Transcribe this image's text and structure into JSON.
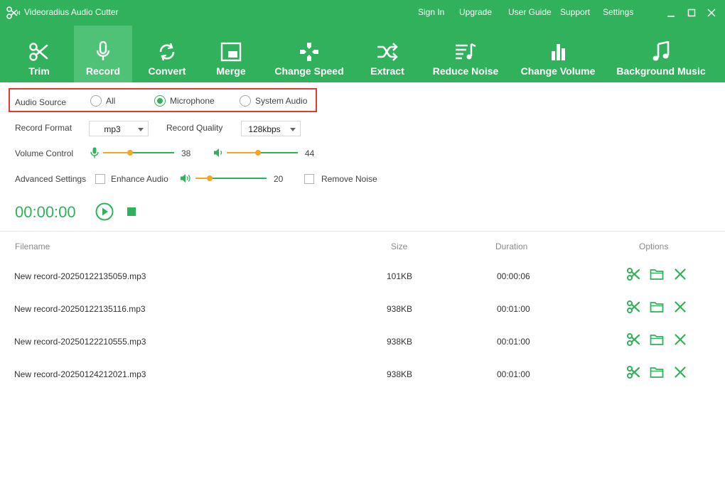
{
  "window": {
    "title": "Videoradius Audio Cutter",
    "menu": [
      "Sign In",
      "Upgrade",
      "User Guide",
      "Support",
      "Settings"
    ]
  },
  "toolbar": {
    "active": "Record",
    "items": [
      {
        "label": "Trim",
        "icon": "scissors-icon"
      },
      {
        "label": "Record",
        "icon": "microphone-icon"
      },
      {
        "label": "Convert",
        "icon": "convert-icon"
      },
      {
        "label": "Merge",
        "icon": "merge-icon"
      },
      {
        "label": "Change Speed",
        "icon": "gamepad-icon"
      },
      {
        "label": "Extract",
        "icon": "shuffle-icon"
      },
      {
        "label": "Reduce Noise",
        "icon": "reduce-noise-icon"
      },
      {
        "label": "Change Volume",
        "icon": "volume-bars-icon"
      },
      {
        "label": "Background Music",
        "icon": "music-note-icon"
      }
    ]
  },
  "settings": {
    "audio_source": {
      "label": "Audio Source",
      "options": [
        "All",
        "Microphone",
        "System Audio"
      ],
      "selected": "Microphone"
    },
    "record_format": {
      "label": "Record Format",
      "value": "mp3"
    },
    "record_quality": {
      "label": "Record Quality",
      "value": "128kbps"
    },
    "volume_control": {
      "label": "Volume Control",
      "microphone": 38,
      "system": 44
    },
    "advanced": {
      "label": "Advanced Settings",
      "enhance_audio_label": "Enhance Audio",
      "enhance_audio_checked": false,
      "enhance_level": 20,
      "remove_noise_label": "Remove Noise",
      "remove_noise_checked": false
    }
  },
  "recorder": {
    "timer": "00:00:00"
  },
  "table": {
    "headers": {
      "filename": "Filename",
      "size": "Size",
      "duration": "Duration",
      "options": "Options"
    },
    "rows": [
      {
        "filename": "New record-20250122135059.mp3",
        "size": "101KB",
        "duration": "00:00:06"
      },
      {
        "filename": "New record-20250122135116.mp3",
        "size": "938KB",
        "duration": "00:01:00"
      },
      {
        "filename": "New record-20250122210555.mp3",
        "size": "938KB",
        "duration": "00:01:00"
      },
      {
        "filename": "New record-20250124212021.mp3",
        "size": "938KB",
        "duration": "00:01:00"
      }
    ]
  },
  "colors": {
    "accent": "#31b15c",
    "active_tab": "#4fc277",
    "slider_knob": "#f5a623",
    "highlight_border": "#e53935"
  }
}
